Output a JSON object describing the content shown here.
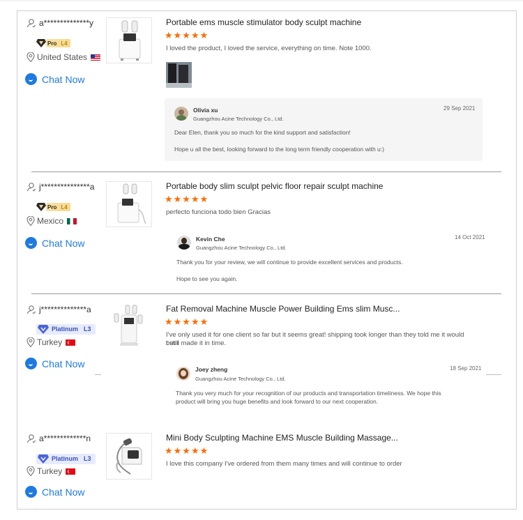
{
  "reviews": [
    {
      "user": "a**************y",
      "badge": {
        "type": "pro",
        "label": "Pro",
        "level": "L4"
      },
      "country": "United States",
      "flag": "us",
      "chat_label": "Chat Now",
      "product_title": "Portable ems muscle stimulator body sculpt machine",
      "stars": "★★★★★",
      "text": "I loved the product, I loved the service, everything on time.  Note 1000.",
      "reply": {
        "name": "Olivia xu",
        "company": "Guangzhou Acine Technology Co., Ltd.",
        "date": "29 Sep 2021",
        "line1": "Dear Elen, thank you so much for the kind support and satisfaction!",
        "line2": "Hope u all the best, looking forward to the long term friendly cooperation with u:)"
      }
    },
    {
      "user": "j***************a",
      "badge": {
        "type": "pro",
        "label": "Pro",
        "level": "L4"
      },
      "country": "Mexico",
      "flag": "mx",
      "chat_label": "Chat Now",
      "product_title": "Portable body slim sculpt pelvic floor repair sculpt machine",
      "stars": "★★★★★",
      "text": "perfecto funciona todo bien Gracias",
      "reply": {
        "name": "Kevin Che",
        "company": "Guangzhou Acine Technology Co., Ltd.",
        "date": "14 Oct 2021",
        "line1": "Thank you for your review, we will continue to provide excellent services and products.",
        "line2": "Hope to see you again."
      }
    },
    {
      "user": "j**************a",
      "badge": {
        "type": "platinum",
        "label": "Platinum",
        "level": "L3"
      },
      "country": "Turkey",
      "flag": "tr",
      "chat_label": "Chat Now",
      "product_title": "Fat Removal Machine Muscle Power Building Ems slim Musc...",
      "stars": "★★★★★",
      "text_line1": "I've only used it for one client so far but it seems great! shipping took longer than they told me it would but i",
      "text_line2": "t still made it in time.",
      "reply": {
        "name": "Joey zheng",
        "company": "Guangzhou Acine Technology Co., Ltd.",
        "date": "18 Sep 2021",
        "line1": "Thank you very much for your recognition of our products and transportation timeliness. We hope this",
        "line2": "product will bring you huge benefits and look forward to our next cooperation."
      }
    },
    {
      "user": "a*************n",
      "badge": {
        "type": "platinum",
        "label": "Platinum",
        "level": "L3"
      },
      "country": "Turkey",
      "flag": "tr",
      "chat_label": "Chat Now",
      "product_title": "Mini Body Sculpting Machine EMS Muscle Building Massage...",
      "stars": "★★★★★",
      "text": "I love this company I've ordered from them many times and will continue to order"
    }
  ],
  "colors": {
    "accent": "#1f7ae0",
    "star": "#ff6a00",
    "border": "#cfcfcf"
  }
}
